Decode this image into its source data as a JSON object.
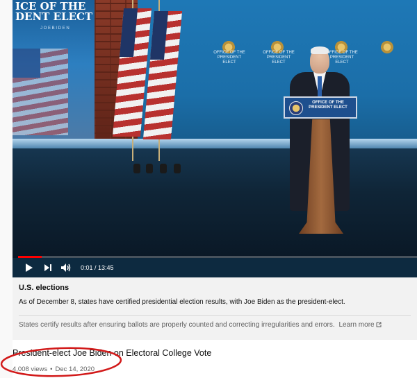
{
  "player": {
    "screen_title_text": "ICE OF THE\nDENT ELECT",
    "screen_subtext": "J O E   B I D E N",
    "seal_labels": [
      "OFFICE OF THE PRESIDENT ELECT",
      "OFFICE OF THE PRESIDENT ELECT",
      "OFFICE OF THE PRESIDENT ELECT"
    ],
    "lectern_sign": "OFFICE OF THE PRESIDENT ELECT",
    "progress_fraction": 0.001,
    "current_time": "0:01",
    "duration": "13:45",
    "time_display": "0:01 / 13:45"
  },
  "info_panel": {
    "title": "U.S. elections",
    "body": "As of December 8, states have certified presidential election results, with Joe Biden as the president-elect.",
    "footer": "States certify results after ensuring ballots are properly counted and correcting irregularities and errors.",
    "learn_more": "Learn more"
  },
  "video": {
    "title": "President-elect Joe Biden on Electoral College Vote",
    "views": "4,008 views",
    "date": "Dec 14, 2020"
  },
  "colors": {
    "progress_played": "#ff0000",
    "annotation_circle": "#d21a1a",
    "panel_bg": "#f2f2f2"
  }
}
